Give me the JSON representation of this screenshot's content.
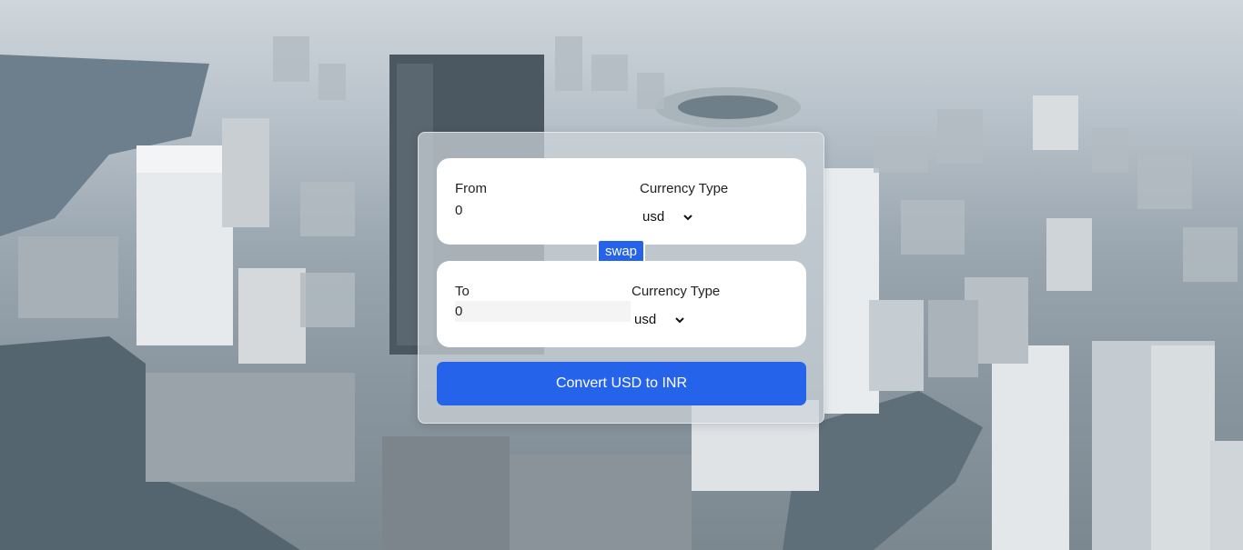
{
  "from": {
    "label": "From",
    "amount": "0",
    "currency_label": "Currency Type",
    "currency_selected": "usd"
  },
  "to": {
    "label": "To",
    "amount": "0",
    "currency_label": "Currency Type",
    "currency_selected": "usd"
  },
  "swap_label": "swap",
  "convert_label": "Convert USD to INR",
  "colors": {
    "accent": "#2563eb",
    "card": "#ffffff"
  },
  "icons": {
    "dropdown": "chevron-down-icon",
    "background": "city-aerial-photo"
  }
}
